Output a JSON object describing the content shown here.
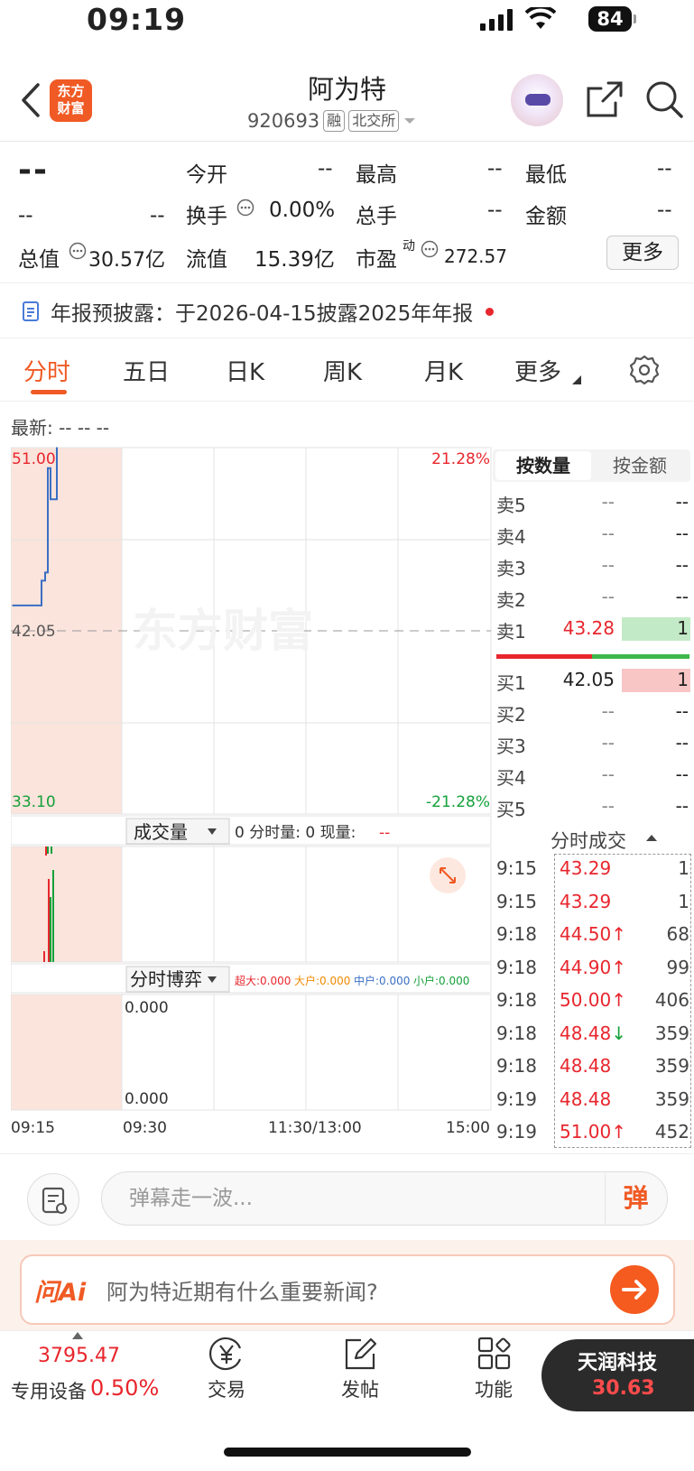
{
  "status_bar": {
    "time": "09:19",
    "battery": "84"
  },
  "header": {
    "logo_text_line1": "东方",
    "logo_text_line2": "财富",
    "stock_name": "阿为特",
    "stock_code": "920693",
    "tag_margin": "融",
    "tag_exchange": "北交所"
  },
  "quote": {
    "price": "--",
    "change": "--",
    "change_pct": "--",
    "open_label": "今开",
    "open_value": "--",
    "high_label": "最高",
    "high_value": "--",
    "low_label": "最低",
    "low_value": "--",
    "turnover_label": "换手",
    "turnover_value": "0.00%",
    "total_hands_label": "总手",
    "total_hands_value": "--",
    "amount_label": "金额",
    "amount_value": "--",
    "total_mv_label": "总值",
    "total_mv_value": "30.57亿",
    "float_mv_label": "流值",
    "float_mv_value": "15.39亿",
    "pe_label": "市盈",
    "pe_sup": "动",
    "pe_value": "272.57",
    "more_button": "更多"
  },
  "notice": {
    "label": "年报预披露：",
    "text": "于2026-04-15披露2025年年报"
  },
  "tabs": [
    "分时",
    "五日",
    "日K",
    "周K",
    "月K",
    "更多"
  ],
  "latest_label": "最新: -- -- --",
  "chart": {
    "price_top": "51.00",
    "pct_top": "21.28%",
    "price_mid": "42.05",
    "price_bottom": "33.10",
    "pct_bottom": "-21.28%",
    "watermark": "东方财富",
    "volume_selector": "成交量",
    "volume_info_a": "0 分时量: 0 现量:",
    "volume_info_b": "--",
    "game_selector": "分时博弈",
    "game_super": "超大:0.000",
    "game_large": "大户:0.000",
    "game_mid": "中户:0.000",
    "game_small": "小户:0.000",
    "game_val_top": "0.000",
    "game_val_bottom": "0.000",
    "x_labels": [
      "09:15",
      "09:30",
      "11:30/13:00",
      "15:00"
    ]
  },
  "chart_data": {
    "type": "line",
    "title": "",
    "x": [
      "09:15",
      "09:15",
      "09:18",
      "09:18",
      "09:18",
      "09:18",
      "09:18",
      "09:19",
      "09:19"
    ],
    "series": [
      {
        "values": [
          43.29,
          43.29,
          44.5,
          44.9,
          50.0,
          48.48,
          48.48,
          48.48,
          51.0
        ]
      }
    ],
    "ylim": [
      33.1,
      51.0
    ],
    "reference": 42.05,
    "xlabel": "",
    "ylabel": ""
  },
  "order_book": {
    "tab_qty": "按数量",
    "tab_amount": "按金额",
    "asks": [
      {
        "label": "卖5",
        "price": "--",
        "vol": "--"
      },
      {
        "label": "卖4",
        "price": "--",
        "vol": "--"
      },
      {
        "label": "卖3",
        "price": "--",
        "vol": "--"
      },
      {
        "label": "卖2",
        "price": "--",
        "vol": "--"
      },
      {
        "label": "卖1",
        "price": "43.28",
        "vol": "1"
      }
    ],
    "bids": [
      {
        "label": "买1",
        "price": "42.05",
        "vol": "1"
      },
      {
        "label": "买2",
        "price": "--",
        "vol": "--"
      },
      {
        "label": "买3",
        "price": "--",
        "vol": "--"
      },
      {
        "label": "买4",
        "price": "--",
        "vol": "--"
      },
      {
        "label": "买5",
        "price": "--",
        "vol": "--"
      }
    ]
  },
  "trades": {
    "title": "分时成交",
    "rows": [
      {
        "time": "9:15",
        "price": "43.29",
        "vol": "1"
      },
      {
        "time": "9:15",
        "price": "43.29",
        "vol": "1"
      },
      {
        "time": "9:18",
        "price": "44.50↑",
        "vol": "68"
      },
      {
        "time": "9:18",
        "price": "44.90↑",
        "vol": "99"
      },
      {
        "time": "9:18",
        "price": "50.00↑",
        "vol": "406"
      },
      {
        "time": "9:18",
        "price": "48.48↓",
        "vol": "359"
      },
      {
        "time": "9:18",
        "price": "48.48",
        "vol": "359"
      },
      {
        "time": "9:19",
        "price": "48.48",
        "vol": "359"
      },
      {
        "time": "9:19",
        "price": "51.00↑",
        "vol": "452"
      }
    ]
  },
  "danmu": {
    "placeholder": "弹幕走一波...",
    "button": "弹"
  },
  "ai": {
    "logo": "问Ai",
    "question": "阿为特近期有什么重要新闻?"
  },
  "bottom_nav": {
    "index_value": "3795.47",
    "sector_name": "专用设备",
    "sector_pct": "0.50%",
    "trade": "交易",
    "post": "发帖",
    "functions": "功能",
    "related_name": "天润科技",
    "related_price": "30.63"
  },
  "colors": {
    "up": "#e8262d",
    "down": "#15a03a",
    "accent": "#f05a24",
    "line": "#3a6fc4"
  }
}
